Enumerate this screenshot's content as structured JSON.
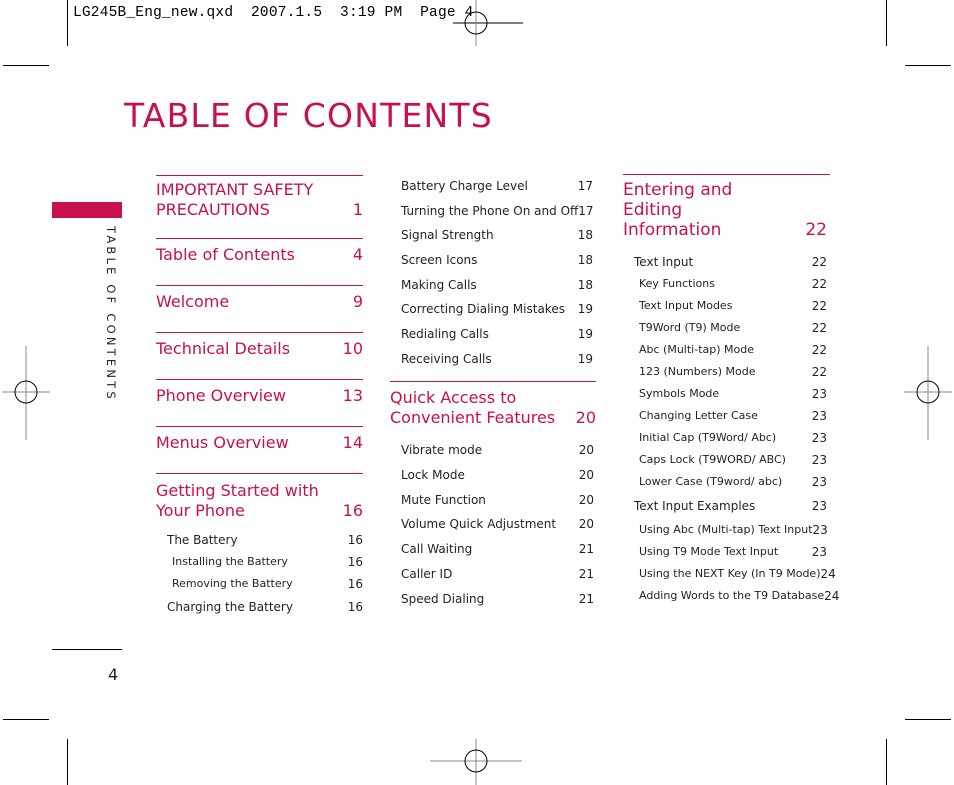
{
  "slug": "LG245B_Eng_new.qxd  2007.1.5  3:19 PM  Page 4",
  "title": "TABLE OF CONTENTS",
  "side_tab": "TABLE OF CONTENTS",
  "page_number": "4",
  "accent_color": "#c8104e",
  "column1": {
    "sections": [
      {
        "title": "IMPORTANT SAFETY PRECAUTIONS",
        "page": "1"
      },
      {
        "title": "Table of Contents",
        "page": "4"
      },
      {
        "title": "Welcome",
        "page": "9"
      },
      {
        "title": "Technical Details",
        "page": "10"
      },
      {
        "title": "Phone Overview",
        "page": "13"
      },
      {
        "title": "Menus Overview",
        "page": "14"
      },
      {
        "title": "Getting Started with Your Phone",
        "page": "16"
      }
    ],
    "entries": [
      {
        "label": "The Battery",
        "page": "16",
        "level": 1
      },
      {
        "label": "Installing the Battery",
        "page": "16",
        "level": 2
      },
      {
        "label": "Removing the Battery",
        "page": "16",
        "level": 2
      },
      {
        "label": "Charging the Battery",
        "page": "16",
        "level": 1
      }
    ]
  },
  "column2": {
    "top_entries": [
      {
        "label": "Battery Charge Level",
        "page": "17"
      },
      {
        "label": "Turning the Phone On and Off",
        "page": "17"
      },
      {
        "label": "Signal Strength",
        "page": "18"
      },
      {
        "label": "Screen Icons",
        "page": "18"
      },
      {
        "label": "Making Calls",
        "page": "18"
      },
      {
        "label": "Correcting Dialing Mistakes",
        "page": "19"
      },
      {
        "label": "Redialing Calls",
        "page": "19"
      },
      {
        "label": "Receiving Calls",
        "page": "19"
      }
    ],
    "section": {
      "title": "Quick Access to Convenient Features",
      "page": "20"
    },
    "entries": [
      {
        "label": "Vibrate mode",
        "page": "20"
      },
      {
        "label": "Lock Mode",
        "page": "20"
      },
      {
        "label": "Mute Function",
        "page": "20"
      },
      {
        "label": "Volume Quick Adjustment",
        "page": "20"
      },
      {
        "label": "Call Waiting",
        "page": "21"
      },
      {
        "label": "Caller ID",
        "page": "21"
      },
      {
        "label": "Speed Dialing",
        "page": "21"
      }
    ]
  },
  "column3": {
    "section": {
      "title": "Entering and Editing Information",
      "page": "22"
    },
    "entries": [
      {
        "label": "Text Input",
        "page": "22",
        "level": 1
      },
      {
        "label": "Key Functions",
        "page": "22",
        "level": 2
      },
      {
        "label": "Text Input Modes",
        "page": "22",
        "level": 2
      },
      {
        "label": "T9Word (T9) Mode",
        "page": "22",
        "level": 2
      },
      {
        "label": "Abc (Multi-tap) Mode",
        "page": "22",
        "level": 2
      },
      {
        "label": "123 (Numbers) Mode",
        "page": "22",
        "level": 2
      },
      {
        "label": "Symbols Mode",
        "page": "23",
        "level": 2
      },
      {
        "label": "Changing Letter Case",
        "page": "23",
        "level": 2
      },
      {
        "label": "Initial Cap (T9Word/ Abc)",
        "page": "23",
        "level": 2
      },
      {
        "label": "Caps Lock (T9WORD/ ABC)",
        "page": "23",
        "level": 2
      },
      {
        "label": "Lower Case (T9word/ abc)",
        "page": "23",
        "level": 2
      },
      {
        "label": "Text Input Examples",
        "page": "23",
        "level": 1
      },
      {
        "label": "Using Abc (Multi-tap) Text Input",
        "page": "23",
        "level": 2
      },
      {
        "label": "Using T9 Mode Text Input",
        "page": "23",
        "level": 2
      },
      {
        "label": "Using the NEXT Key (In T9 Mode)",
        "page": "24",
        "level": 2
      },
      {
        "label": "Adding Words to the T9 Database",
        "page": "24",
        "level": 2
      }
    ]
  }
}
